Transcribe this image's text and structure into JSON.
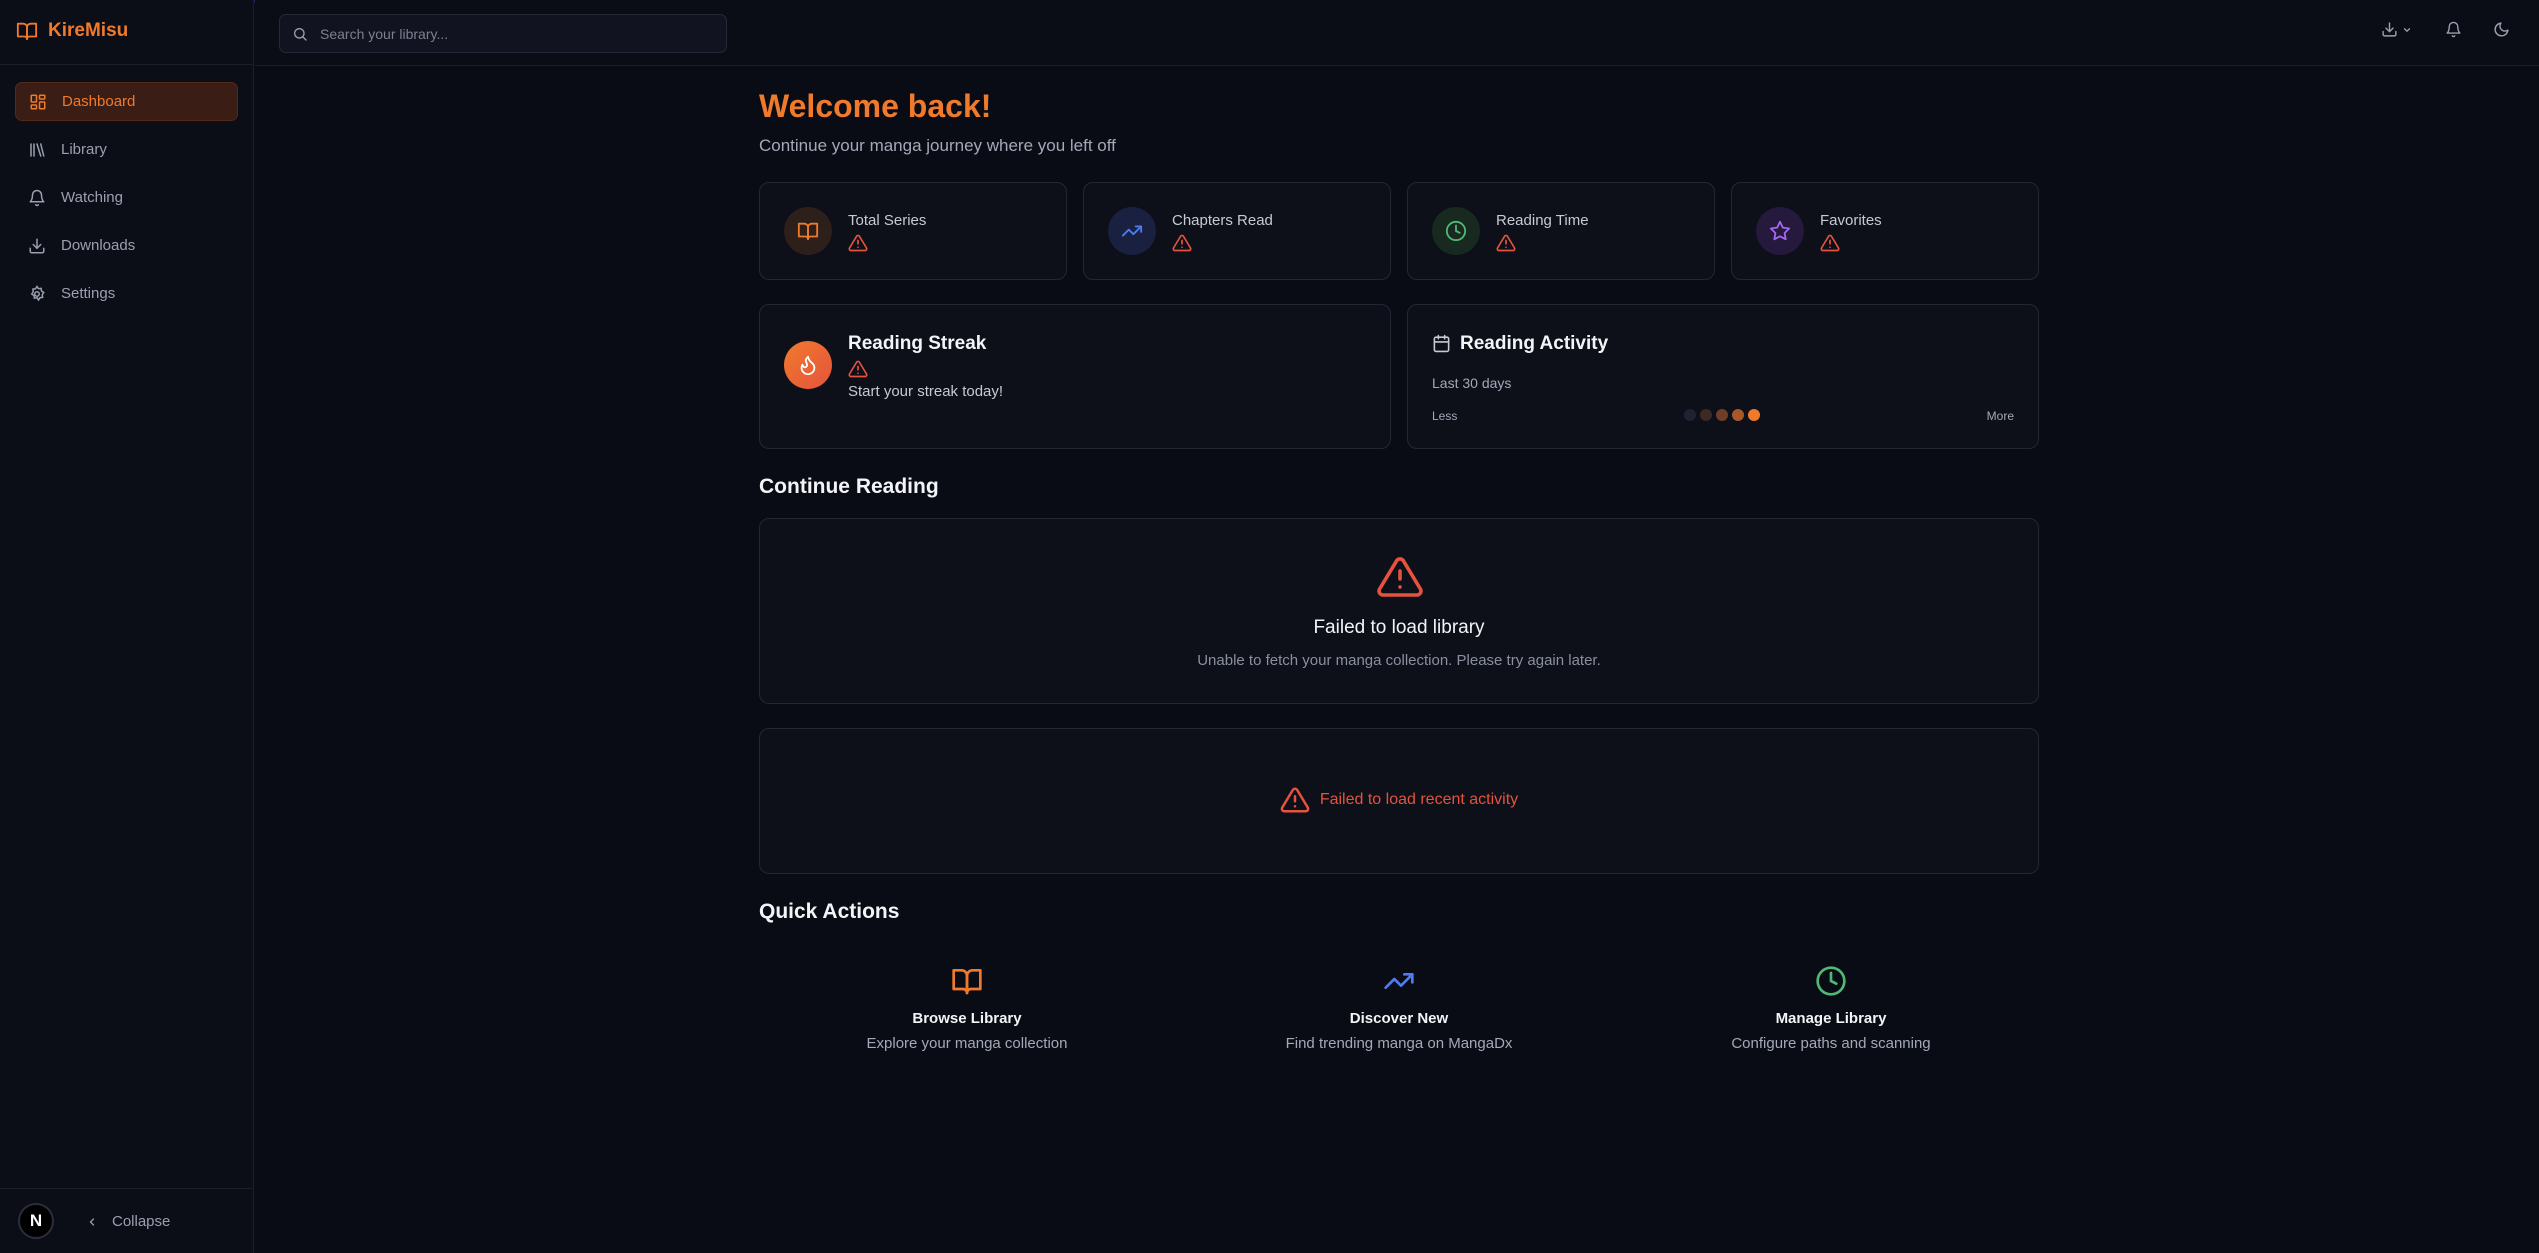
{
  "app": {
    "name": "KireMisu"
  },
  "sidebar": {
    "items": [
      {
        "label": "Dashboard",
        "icon": "dashboard-icon",
        "active": true
      },
      {
        "label": "Library",
        "icon": "library-icon",
        "active": false
      },
      {
        "label": "Watching",
        "icon": "bell-icon",
        "active": false
      },
      {
        "label": "Downloads",
        "icon": "download-icon",
        "active": false
      },
      {
        "label": "Settings",
        "icon": "gear-icon",
        "active": false
      }
    ],
    "avatar_letter": "N",
    "collapse_label": "Collapse"
  },
  "header": {
    "search_placeholder": "Search your library..."
  },
  "welcome": {
    "title": "Welcome back!",
    "subtitle": "Continue your manga journey where you left off"
  },
  "stats": [
    {
      "label": "Total Series",
      "icon": "book-open-icon",
      "color": "#f07a2c"
    },
    {
      "label": "Chapters Read",
      "icon": "trending-up-icon",
      "color": "#4c7cf0"
    },
    {
      "label": "Reading Time",
      "icon": "clock-icon",
      "color": "#4fb873"
    },
    {
      "label": "Favorites",
      "icon": "star-icon",
      "color": "#a366f0"
    }
  ],
  "streak": {
    "title": "Reading Streak",
    "message": "Start your streak today!"
  },
  "activity": {
    "title": "Reading Activity",
    "range": "Last 30 days",
    "less_label": "Less",
    "more_label": "More"
  },
  "continue_reading": {
    "title": "Continue Reading",
    "error_title": "Failed to load library",
    "error_message": "Unable to fetch your manga collection. Please try again later."
  },
  "recent_activity": {
    "error_message": "Failed to load recent activity"
  },
  "quick_actions": {
    "title": "Quick Actions",
    "items": [
      {
        "title": "Browse Library",
        "description": "Explore your manga collection",
        "icon": "book-open-icon",
        "color": "#f07a2c"
      },
      {
        "title": "Discover New",
        "description": "Find trending manga on MangaDx",
        "icon": "trending-up-icon",
        "color": "#4c7cf0"
      },
      {
        "title": "Manage Library",
        "description": "Configure paths and scanning",
        "icon": "clock-icon",
        "color": "#4fb873"
      }
    ]
  },
  "colors": {
    "accent": "#f07a2c",
    "error": "#e5533d",
    "background": "#0a0c15"
  }
}
